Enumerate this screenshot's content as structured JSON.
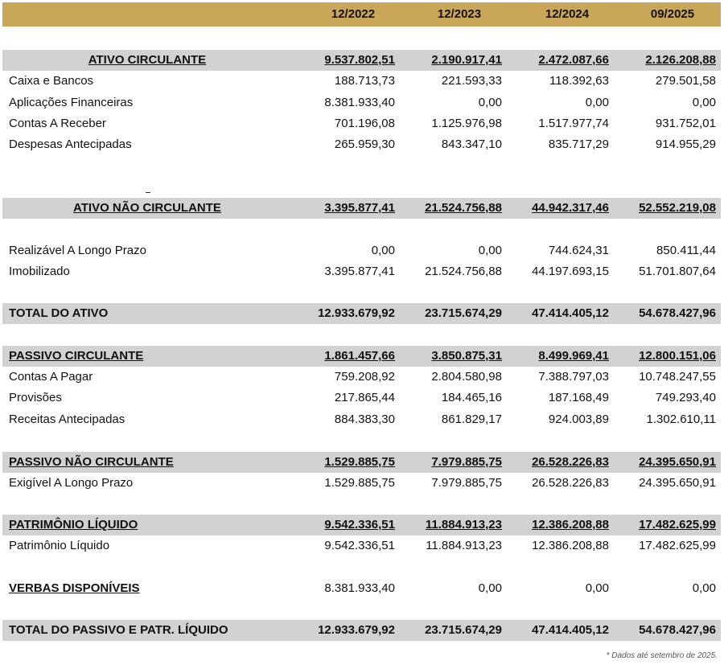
{
  "header": {
    "periods": [
      "12/2022",
      "12/2023",
      "12/2024",
      "09/2025"
    ]
  },
  "sections": {
    "ativo_circulante": {
      "label": "ATIVO CIRCULANTE",
      "values": [
        "9.537.802,51",
        "2.190.917,41",
        "2.472.087,66",
        "2.126.208,88"
      ],
      "items": [
        {
          "label": "Caixa e Bancos",
          "values": [
            "188.713,73",
            "221.593,33",
            "118.392,63",
            "279.501,58"
          ]
        },
        {
          "label": "Aplicações Financeiras",
          "values": [
            "8.381.933,40",
            "0,00",
            "0,00",
            "0,00"
          ]
        },
        {
          "label": "Contas A Receber",
          "values": [
            "701.196,08",
            "1.125.976,98",
            "1.517.977,74",
            "931.752,01"
          ]
        },
        {
          "label": "Despesas Antecipadas",
          "values": [
            "265.959,30",
            "843.347,10",
            "835.717,29",
            "914.955,29"
          ]
        }
      ]
    },
    "ativo_nao_circulante": {
      "label": "ATIVO NÃO CIRCULANTE",
      "values": [
        "3.395.877,41",
        "21.524.756,88",
        "44.942.317,46",
        "52.552.219,08"
      ],
      "items": [
        {
          "label": "Realizável A Longo Prazo",
          "values": [
            "0,00",
            "0,00",
            "744.624,31",
            "850.411,44"
          ]
        },
        {
          "label": "Imobilizado",
          "values": [
            "3.395.877,41",
            "21.524.756,88",
            "44.197.693,15",
            "51.701.807,64"
          ]
        }
      ]
    },
    "total_ativo": {
      "label": "TOTAL DO ATIVO",
      "values": [
        "12.933.679,92",
        "23.715.674,29",
        "47.414.405,12",
        "54.678.427,96"
      ]
    },
    "passivo_circulante": {
      "label": "PASSIVO CIRCULANTE",
      "values": [
        "1.861.457,66",
        "3.850.875,31",
        "8.499.969,41",
        "12.800.151,06"
      ],
      "items": [
        {
          "label": "Contas A Pagar",
          "values": [
            "759.208,92",
            "2.804.580,98",
            "7.388.797,03",
            "10.748.247,55"
          ]
        },
        {
          "label": "Provisões",
          "values": [
            "217.865,44",
            "184.465,16",
            "187.168,49",
            "749.293,40"
          ]
        },
        {
          "label": "Receitas Antecipadas",
          "values": [
            "884.383,30",
            "861.829,17",
            "924.003,89",
            "1.302.610,11"
          ]
        }
      ]
    },
    "passivo_nao_circulante": {
      "label": "PASSIVO NÃO CIRCULANTE",
      "values": [
        "1.529.885,75",
        "7.979.885,75",
        "26.528.226,83",
        "24.395.650,91"
      ],
      "items": [
        {
          "label": "Exigível A Longo Prazo",
          "values": [
            "1.529.885,75",
            "7.979.885,75",
            "26.528.226,83",
            "24.395.650,91"
          ]
        }
      ]
    },
    "patrimonio_liquido": {
      "label": "PATRIMÔNIO LÍQUIDO",
      "values": [
        "9.542.336,51",
        "11.884.913,23",
        "12.386.208,88",
        "17.482.625,99"
      ],
      "items": [
        {
          "label": "Patrimônio Líquido",
          "values": [
            "9.542.336,51",
            "11.884.913,23",
            "12.386.208,88",
            "17.482.625,99"
          ]
        }
      ]
    },
    "verbas_disponiveis": {
      "label": "VERBAS DISPONÍVEIS",
      "values": [
        "8.381.933,40",
        "0,00",
        "0,00",
        "0,00"
      ]
    },
    "total_passivo": {
      "label": "TOTAL DO PASSIVO E PATR. LÍQUIDO",
      "values": [
        "12.933.679,92",
        "23.715.674,29",
        "47.414.405,12",
        "54.678.427,96"
      ]
    }
  },
  "footnote": "* Dados até setembro de 2025."
}
